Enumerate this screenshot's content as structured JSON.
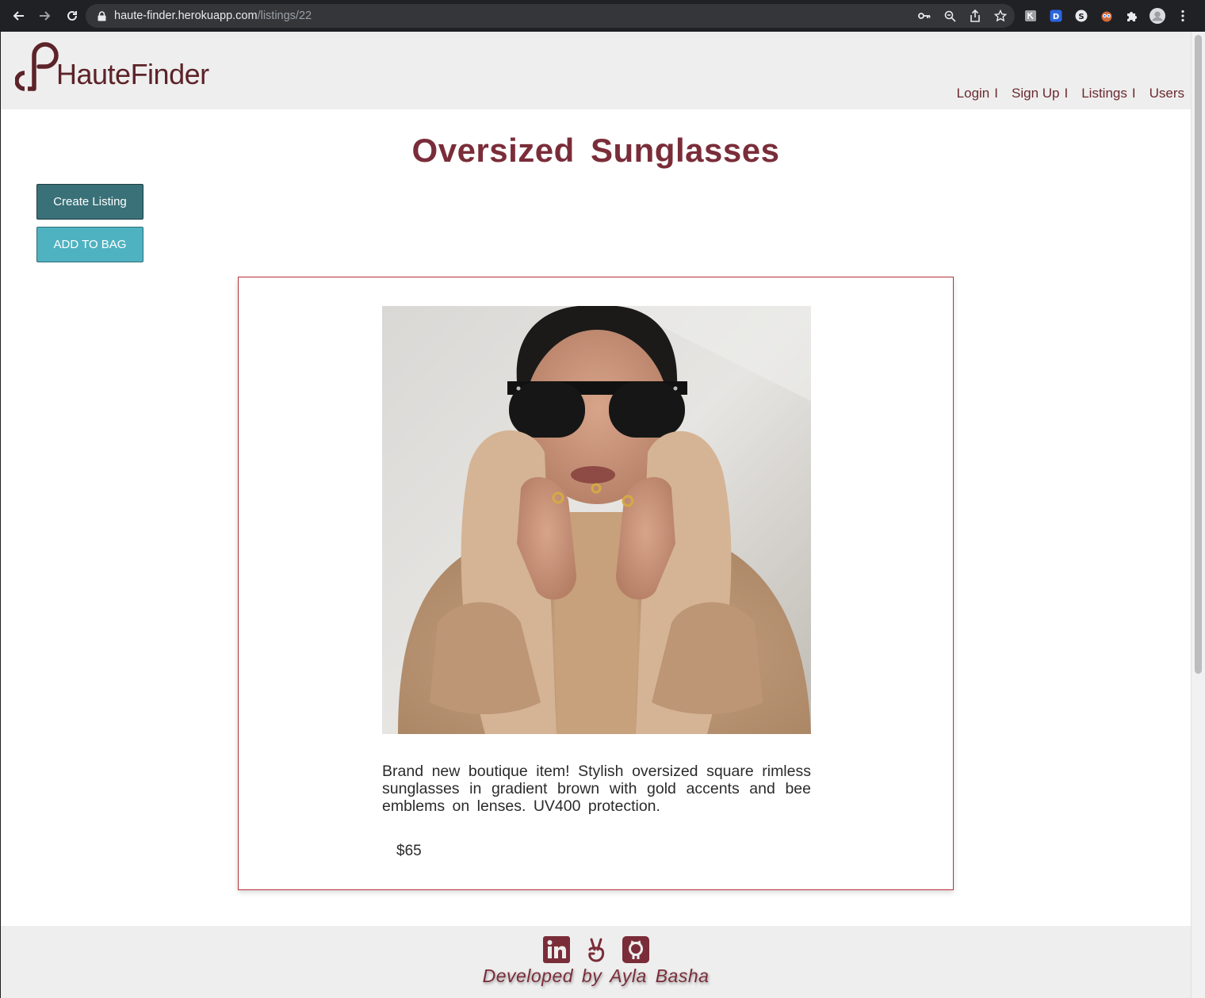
{
  "browser": {
    "url_host": "haute-finder.herokuapp.com",
    "url_path": "/listings/22",
    "extensions": [
      "extension-gray-icon",
      "extension-d-icon",
      "extension-s-icon",
      "extension-owl-icon",
      "puzzle-icon",
      "profile-avatar-icon"
    ]
  },
  "site": {
    "brand": "HauteFinder",
    "nav": [
      {
        "label": "Login"
      },
      {
        "label": "Sign Up"
      },
      {
        "label": "Listings"
      },
      {
        "label": "Users"
      }
    ],
    "nav_separator": "I"
  },
  "listing": {
    "title": "Oversized Sunglasses",
    "description": "Brand new boutique item! Stylish oversized square rimless sunglasses in gradient brown with gold accents and bee emblems on lenses. UV400 protection.",
    "price": "$65",
    "image_alt": "woman in oversized sunglasses and teddy coat"
  },
  "actions": {
    "create_label": "Create Listing",
    "add_to_bag_label": "ADD TO BAG"
  },
  "footer": {
    "credit": "Developed by Ayla Basha",
    "social_icons": [
      "linkedin-icon",
      "angellist-icon",
      "github-icon"
    ]
  },
  "colors": {
    "brand": "#6b2a2f",
    "title": "#7a2d39",
    "create_button": "#3a7179",
    "bag_button": "#4fb2c1",
    "card_border": "#b8323c",
    "header_bg": "#eeeeee"
  }
}
